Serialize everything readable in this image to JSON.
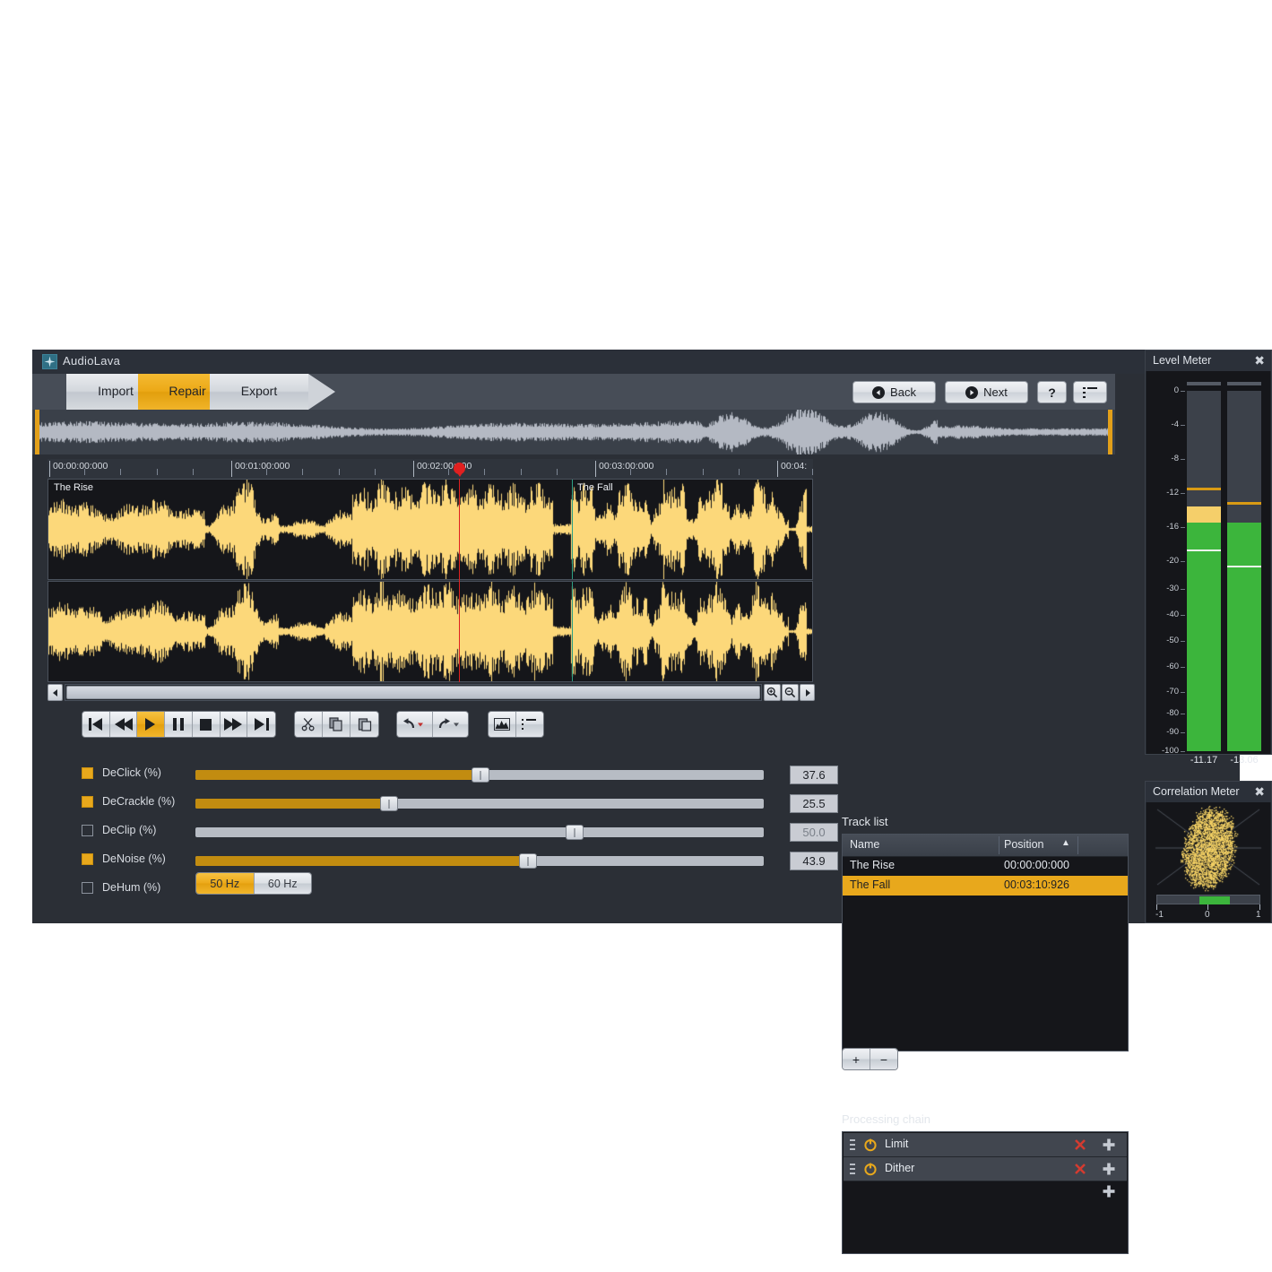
{
  "window": {
    "title": "AudioLava",
    "icon": "sparkle-icon",
    "minimize": "–",
    "maximize": "□",
    "close": "✕"
  },
  "wizard": {
    "steps": [
      {
        "label": "Import",
        "active": false
      },
      {
        "label": "Repair",
        "active": true
      },
      {
        "label": "Export",
        "active": false
      }
    ],
    "back_label": "Back",
    "next_label": "Next",
    "help_label": "?",
    "list_label": ""
  },
  "ruler": {
    "labels": [
      "00:00:00:000",
      "00:01:00:000",
      "00:02:00:000",
      "00:03:00:000",
      "00:04:"
    ]
  },
  "editor": {
    "clips": [
      {
        "name": "The Rise"
      },
      {
        "name": "The Fall"
      }
    ],
    "playhead_time": "00:02:00:000"
  },
  "transport": {
    "buttons": [
      {
        "name": "skip-to-start-button",
        "icon": "skip-back-icon",
        "active": false
      },
      {
        "name": "rewind-button",
        "icon": "rewind-icon",
        "active": false
      },
      {
        "name": "play-button",
        "icon": "play-icon",
        "active": true
      },
      {
        "name": "pause-button",
        "icon": "pause-icon",
        "active": false
      },
      {
        "name": "stop-button",
        "icon": "stop-icon",
        "active": false
      },
      {
        "name": "fast-forward-button",
        "icon": "fast-forward-icon",
        "active": false
      },
      {
        "name": "skip-to-end-button",
        "icon": "skip-forward-icon",
        "active": false
      }
    ],
    "edit_buttons": [
      "cut-icon",
      "copy-icon",
      "paste-icon"
    ],
    "history_buttons": [
      "undo-icon",
      "redo-icon"
    ],
    "view_buttons": [
      "waveform-view-icon",
      "list-view-icon"
    ]
  },
  "scrollbar": {
    "left_arrow": "◀",
    "right_arrow": "▶",
    "zoom_in": "zoom-in-icon",
    "zoom_out": "zoom-out-icon"
  },
  "repair": {
    "sliders": [
      {
        "label": "DeClick (%)",
        "value": "37.6",
        "enabled": true,
        "percent": 37.6
      },
      {
        "label": "DeCrackle (%)",
        "value": "25.5",
        "enabled": true,
        "percent": 25.5
      },
      {
        "label": "DeClip (%)",
        "value": "50.0",
        "enabled": false,
        "percent": 50.0
      },
      {
        "label": "DeNoise (%)",
        "value": "43.9",
        "enabled": true,
        "percent": 43.9
      }
    ],
    "dehum": {
      "label": "DeHum (%)",
      "enabled": false,
      "options": [
        {
          "label": "50 Hz",
          "selected": true
        },
        {
          "label": "60 Hz",
          "selected": false
        }
      ]
    }
  },
  "track_list": {
    "title": "Track list",
    "columns": [
      "Name",
      "Position"
    ],
    "sort_indicator": "▲",
    "rows": [
      {
        "name": "The Rise",
        "position": "00:00:00:000",
        "selected": false
      },
      {
        "name": "The Fall",
        "position": "00:03:10:926",
        "selected": true
      }
    ],
    "add_label": "+",
    "remove_label": "−"
  },
  "processing_chain": {
    "title": "Processing chain",
    "items": [
      {
        "name": "Limit",
        "enabled": true
      },
      {
        "name": "Dither",
        "enabled": true
      }
    ],
    "remove_icon": "close-x-icon",
    "add_icon": "plus-icon"
  },
  "level_meter": {
    "title": "Level Meter",
    "close": "✖",
    "scale": [
      "0",
      "-4",
      "-8",
      "-12",
      "-16",
      "-20",
      "-30",
      "-40",
      "-50",
      "-60",
      "-70",
      "-80",
      "-90",
      "-100"
    ],
    "channels": [
      {
        "value": "-11.17",
        "level_db": -13.6,
        "peak_hold_db": -11.4,
        "rms_db": -18.6
      },
      {
        "value": "-13.06",
        "level_db": -15.5,
        "peak_hold_db": -13.1,
        "rms_db": -21.7
      }
    ]
  },
  "correlation_meter": {
    "title": "Correlation Meter",
    "close": "✖",
    "scale": [
      "-1",
      "0",
      "1"
    ],
    "value": 0.12
  },
  "colors": {
    "accent": "#e8a81c",
    "waveform": "#fcd87a",
    "panel_bg": "#2b2f36",
    "wave_bg": "#15161a",
    "meter_green": "#3cb53c",
    "playhead": "#e02020",
    "clip_divider": "#2ea083"
  }
}
